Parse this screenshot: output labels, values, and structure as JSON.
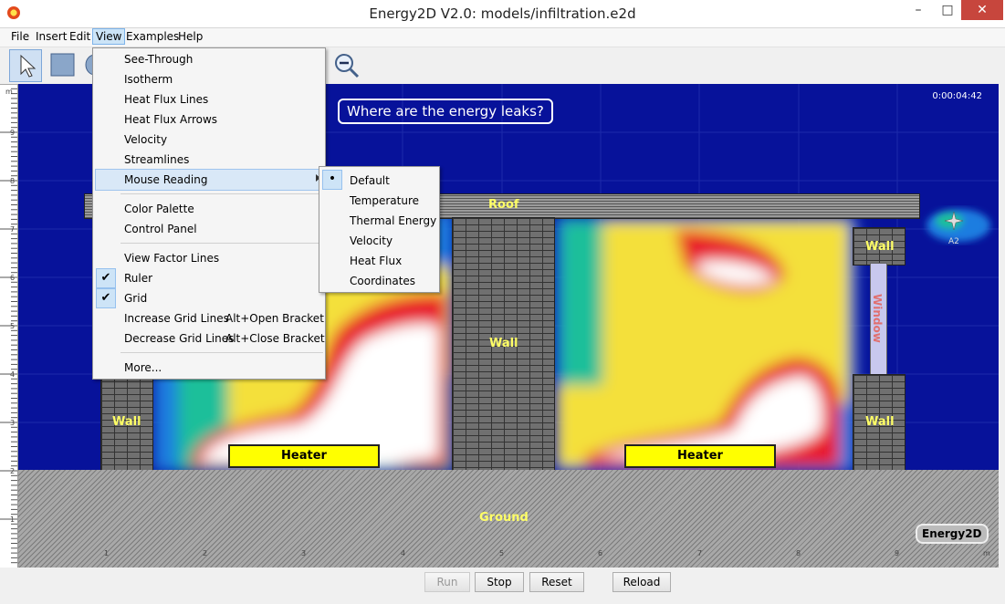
{
  "window": {
    "title": "Energy2D V2.0: models/infiltration.e2d"
  },
  "menubar": {
    "items": [
      "File",
      "Insert",
      "Edit",
      "View",
      "Examples",
      "Help"
    ]
  },
  "view_menu": {
    "items": [
      {
        "label": "See-Through"
      },
      {
        "label": "Isotherm"
      },
      {
        "label": "Heat Flux Lines"
      },
      {
        "label": "Heat Flux Arrows"
      },
      {
        "label": "Velocity"
      },
      {
        "label": "Streamlines"
      },
      {
        "label": "Mouse Reading"
      },
      {
        "label": "Color Palette"
      },
      {
        "label": "Control Panel"
      },
      {
        "label": "View Factor Lines"
      },
      {
        "label": "Ruler"
      },
      {
        "label": "Grid"
      },
      {
        "label": "Increase Grid Lines",
        "shortcut": "Alt+Open Bracket"
      },
      {
        "label": "Decrease Grid Lines",
        "shortcut": "Alt+Close Bracket"
      },
      {
        "label": "More..."
      }
    ],
    "checked": [
      "Ruler",
      "Grid"
    ]
  },
  "mouse_reading_submenu": {
    "items": [
      "Default",
      "Temperature",
      "Thermal Energy",
      "Velocity",
      "Heat Flux",
      "Coordinates"
    ],
    "selected": "Default"
  },
  "simulation": {
    "question": "Where are the energy leaks?",
    "time": "0:00:04:42",
    "labels": {
      "roof": "Roof",
      "wall_left": "Wall",
      "wall_middle": "Wall",
      "wall_right_top": "Wall",
      "wall_right_bottom": "Wall",
      "window": "Window",
      "heater_left": "Heater",
      "heater_right": "Heater",
      "ground": "Ground"
    },
    "sensor": "A2",
    "badge": "Energy2D",
    "ruler_left_unit": "m",
    "ruler_left_ticks": [
      "9",
      "8",
      "7",
      "6",
      "5",
      "4",
      "3",
      "2",
      "1"
    ],
    "ruler_bottom_unit": "m",
    "ruler_bottom_ticks": [
      "1",
      "2",
      "3",
      "4",
      "5",
      "6",
      "7",
      "8",
      "9"
    ]
  },
  "controls": {
    "run": "Run",
    "stop": "Stop",
    "reset": "Reset",
    "reload": "Reload"
  },
  "colors": {
    "cold": "#07129a",
    "warm": "#e8192a",
    "hot": "#ffffff",
    "heater": "#ffff00"
  }
}
